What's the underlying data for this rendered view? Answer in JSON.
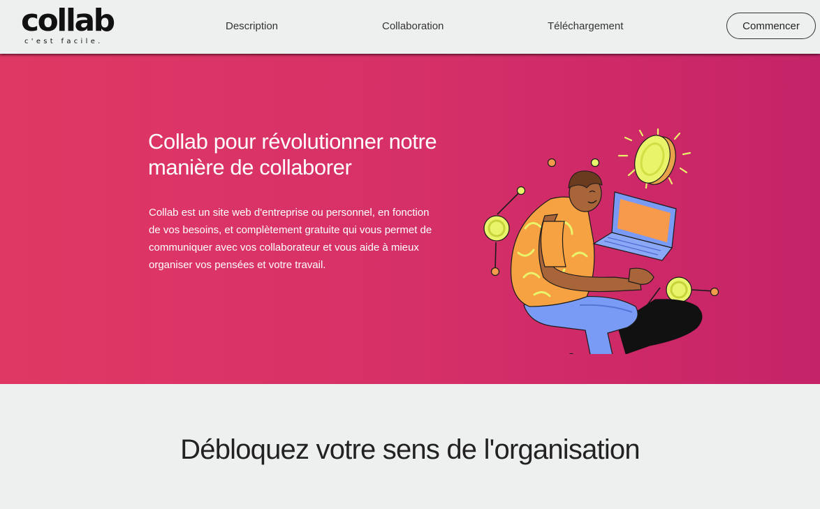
{
  "brand": {
    "name": "collab",
    "tagline": "c'est facile."
  },
  "nav": {
    "links": [
      {
        "label": "Description"
      },
      {
        "label": "Collaboration"
      },
      {
        "label": "Téléchargement"
      }
    ],
    "cta_label": "Commencer"
  },
  "hero": {
    "title": "Collab pour révolutionner notre manière de collaborer",
    "text": "Collab est un site web d'entreprise ou personnel, en fonction de vos besoins, et complètement gratuite qui vous permet de communiquer avec vos collaborateur et vous aide à mieux organiser vos pensées et votre travail."
  },
  "section": {
    "title": "Débloquez votre sens de l'organisation"
  },
  "colors": {
    "hero_start": "#e03864",
    "hero_end": "#c52368",
    "page_bg": "#eef0ef",
    "accent_yellow": "#e9f46a",
    "accent_orange": "#f79a4c"
  }
}
